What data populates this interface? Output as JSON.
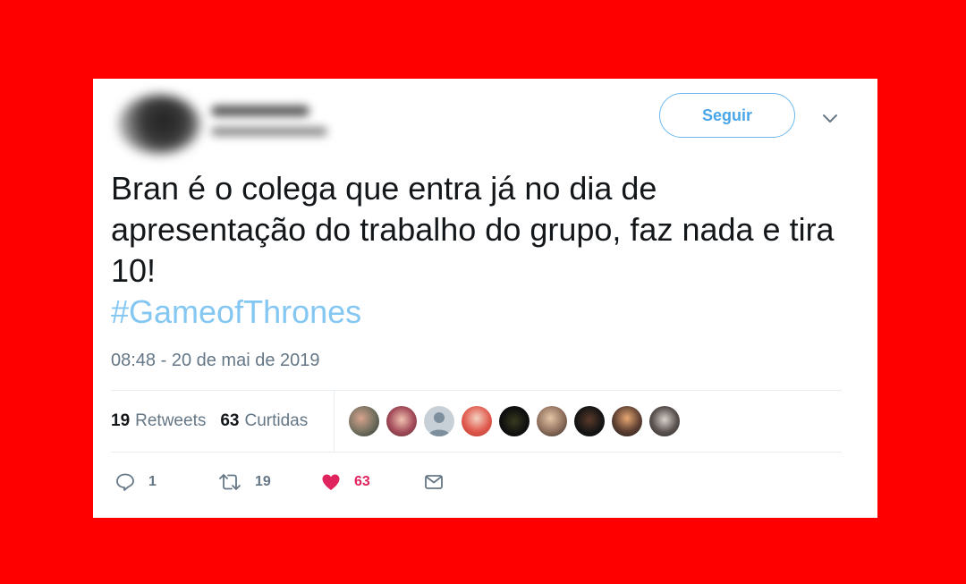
{
  "follow_button": {
    "label": "Seguir"
  },
  "tweet": {
    "text": "Bran é o colega que entra já no dia de apresentação do trabalho do grupo, faz nada e tira 10!",
    "hashtag": "#GameofThrones",
    "timestamp": "08:48 - 20 de mai de 2019"
  },
  "stats": {
    "retweets_count": "19",
    "retweets_label": "Retweets",
    "likes_count": "63",
    "likes_label": "Curtidas"
  },
  "actions": {
    "reply_count": "1",
    "retweet_count": "19",
    "like_count": "63"
  },
  "colors": {
    "background": "#ff0000",
    "card": "#ffffff",
    "accent": "#4aa6e8",
    "hashtag": "#84c7f2",
    "like": "#e0245e",
    "muted": "#657786"
  },
  "icons": {
    "caret": "chevron-down-icon",
    "reply": "reply-icon",
    "retweet": "retweet-icon",
    "like": "heart-icon",
    "message": "envelope-icon"
  }
}
